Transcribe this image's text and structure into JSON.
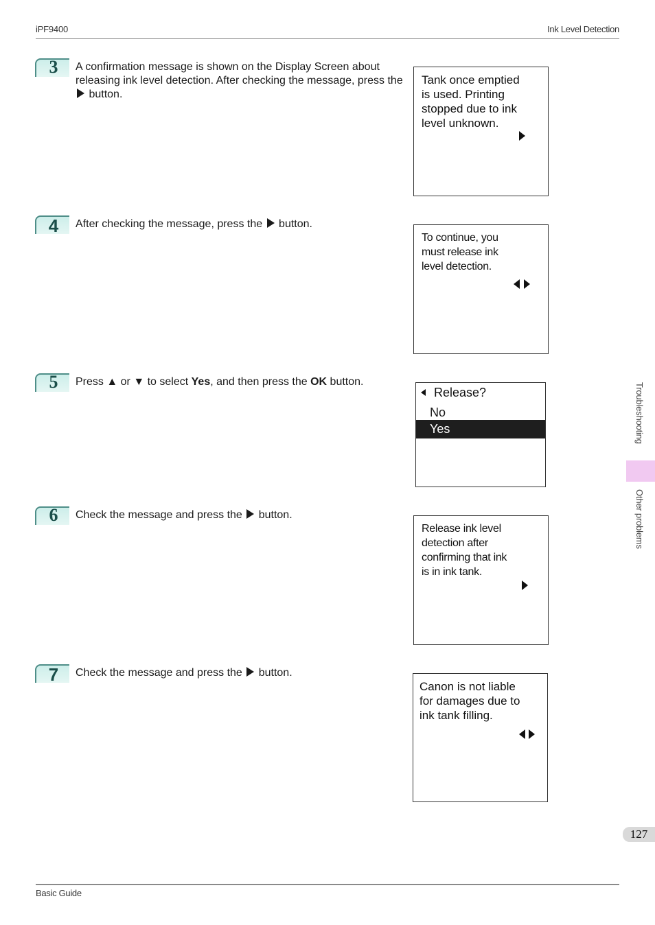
{
  "header": {
    "model": "iPF9400",
    "section": "Ink Level Detection"
  },
  "footer": {
    "guide": "Basic Guide",
    "page_number": "127"
  },
  "side_nav": {
    "chapter": "Troubleshooting",
    "subsection": "Other problems",
    "highlight_color": "#f1c9f1"
  },
  "steps": [
    {
      "number": "3",
      "text_before": "A confirmation message is shown on the Display Screen about releasing ink level detection. After checking the message, press the",
      "button_icon": "right-arrow-icon",
      "text_after": "button.",
      "lcd": {
        "lines": [
          "Tank once emptied",
          "is used. Printing",
          "stopped due to ink",
          "level unknown."
        ],
        "nav": "right"
      }
    },
    {
      "number": "4",
      "text_before": "After checking the message, press the",
      "button_icon": "right-arrow-icon",
      "text_after": "button.",
      "lcd": {
        "lines": [
          "To continue, you",
          "must release ink",
          "level detection."
        ],
        "nav": "left-right"
      }
    },
    {
      "number": "5",
      "text_parts": [
        "Press ",
        "▲",
        " or ",
        "▼",
        " to select ",
        "Yes",
        ", and then press the ",
        "OK",
        " button."
      ],
      "lcd": {
        "title": "Release?",
        "options": [
          "No",
          "Yes"
        ],
        "selected": "Yes"
      }
    },
    {
      "number": "6",
      "text_before": "Check the message and press the",
      "button_icon": "right-arrow-icon",
      "text_after": "button.",
      "lcd": {
        "lines": [
          "Release ink level",
          "detection after",
          "confirming that ink",
          "is in ink tank."
        ],
        "nav": "right"
      }
    },
    {
      "number": "7",
      "text_before": "Check the message and press the",
      "button_icon": "right-arrow-icon",
      "text_after": "button.",
      "lcd": {
        "lines": [
          "Canon is not liable",
          "for damages due to",
          "ink tank filling."
        ],
        "nav": "left-right"
      }
    }
  ]
}
